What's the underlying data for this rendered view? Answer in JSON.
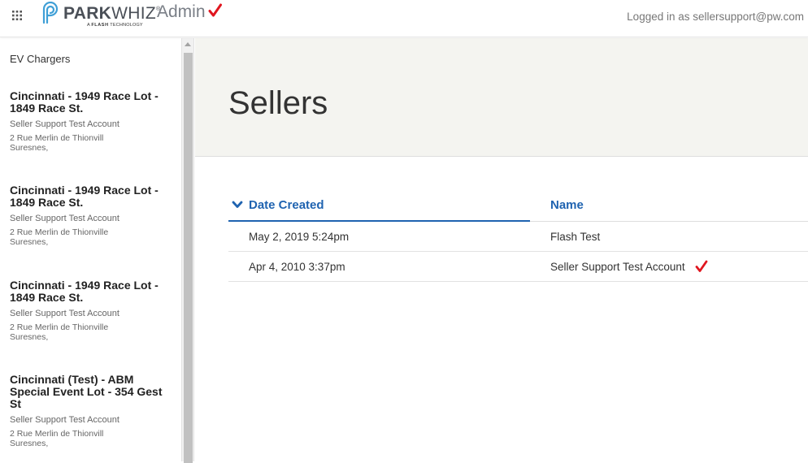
{
  "header": {
    "brand_park": "PARK",
    "brand_whiz": "WHIZ",
    "brand_tm": "®",
    "brand_sub_prefix": "A",
    "brand_sub_flash": "FLASH",
    "brand_sub_suffix": "TECHNOLOGY",
    "admin_label": "Admin",
    "logged_in_text": "Logged in as sellersupport@pw.com"
  },
  "sidebar": {
    "heading": "EV Chargers",
    "lots": [
      {
        "name": "Cincinnati - 1949 Race Lot - 1849 Race St.",
        "account": "Seller Support Test Account",
        "address_line1": "2 Rue Merlin de Thionvill",
        "address_line2": "Suresnes,"
      },
      {
        "name": "Cincinnati - 1949 Race Lot - 1849 Race St.",
        "account": "Seller Support Test Account",
        "address_line1": "2 Rue Merlin de Thionville",
        "address_line2": "Suresnes,"
      },
      {
        "name": "Cincinnati - 1949 Race Lot - 1849 Race St.",
        "account": "Seller Support Test Account",
        "address_line1": "2 Rue Merlin de Thionville",
        "address_line2": "Suresnes,"
      },
      {
        "name": "Cincinnati (Test) - ABM Special Event Lot - 354 Gest St",
        "account": "Seller Support Test Account",
        "address_line1": "2 Rue Merlin de Thionvill",
        "address_line2": "Suresnes,"
      }
    ]
  },
  "main": {
    "title": "Sellers",
    "table": {
      "columns": [
        "Date Created",
        "Name"
      ],
      "sort_column": "Date Created",
      "rows": [
        {
          "date": "May 2, 2019 5:24pm",
          "name": "Flash Test",
          "checked": false
        },
        {
          "date": "Apr 4, 2010 3:37pm",
          "name": "Seller Support Test Account",
          "checked": true
        }
      ]
    }
  },
  "colors": {
    "accent": "#1f63b0",
    "check": "#e0161f",
    "banner": "#f4f4f0"
  }
}
